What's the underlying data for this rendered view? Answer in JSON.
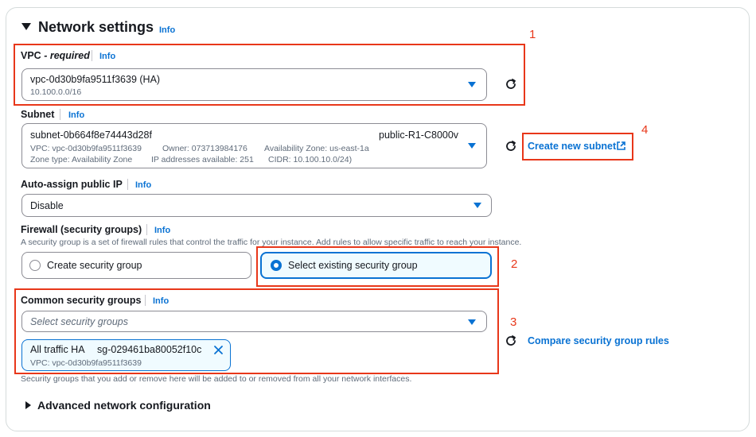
{
  "section": {
    "title": "Network settings",
    "info": "Info"
  },
  "vpc": {
    "label": "VPC",
    "label_suffix": "- required",
    "info": "Info",
    "value": "vpc-0d30b9fa9511f3639 (HA)",
    "subvalue": "10.100.0.0/16"
  },
  "subnet": {
    "label": "Subnet",
    "info": "Info",
    "value": "subnet-0b664f8e74443d28f",
    "name": "public-R1-C8000v",
    "line1_vpc": "VPC: vpc-0d30b9fa9511f3639",
    "line1_owner": "Owner: 073713984176",
    "line1_az": "Availability Zone: us-east-1a",
    "line2_zone_type": "Zone type: Availability Zone",
    "line2_ips": "IP addresses available: 251",
    "line2_cidr": "CIDR: 10.100.10.0/24)",
    "create_link": "Create new subnet"
  },
  "auto_ip": {
    "label": "Auto-assign public IP",
    "info": "Info",
    "value": "Disable"
  },
  "firewall": {
    "label": "Firewall (security groups)",
    "info": "Info",
    "description": "A security group is a set of firewall rules that control the traffic for your instance. Add rules to allow specific traffic to reach your instance.",
    "options": [
      {
        "label": "Create security group",
        "selected": false
      },
      {
        "label": "Select existing security group",
        "selected": true
      }
    ]
  },
  "common_sg": {
    "label": "Common security groups",
    "info": "Info",
    "placeholder": "Select security groups",
    "compare_link": "Compare security group rules",
    "token": {
      "name": "All traffic HA",
      "id": "sg-029461ba80052f10c",
      "vpc": "VPC: vpc-0d30b9fa9511f3639"
    },
    "description": "Security groups that you add or remove here will be added to or removed from all your network interfaces."
  },
  "advanced": {
    "title": "Advanced network configuration"
  },
  "annotations": {
    "n1": "1",
    "n2": "2",
    "n3": "3",
    "n4": "4",
    "color": "#e8371a"
  },
  "colors": {
    "accent": "#0972d3",
    "text": "#16191f",
    "muted": "#5f6b7a"
  },
  "icons": {
    "refresh": "refresh-icon",
    "external": "external-link-icon",
    "dismiss": "close-icon"
  }
}
